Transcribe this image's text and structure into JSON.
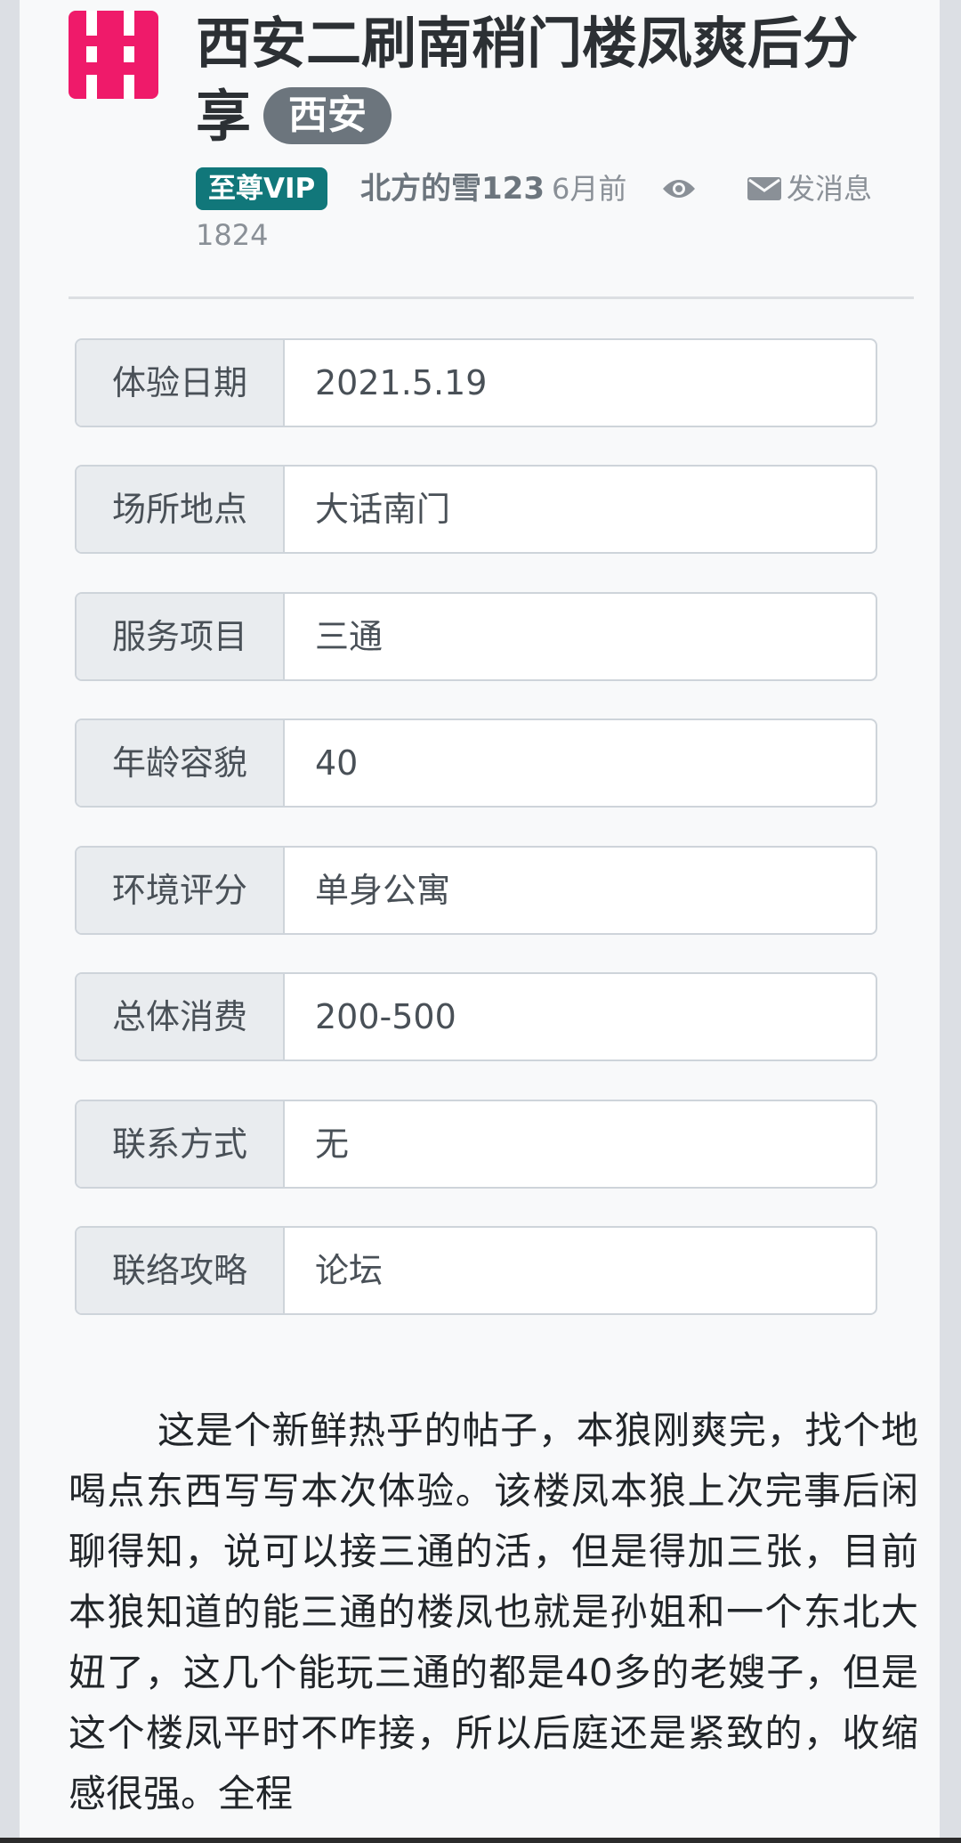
{
  "post": {
    "title": "西安二刷南稍门楼凤爽后分享",
    "city": "西安",
    "vip_badge": "至尊VIP",
    "author": "北方的雪123",
    "time": "6月前",
    "views": "1824",
    "message_button": "发消息"
  },
  "details": [
    {
      "label": "体验日期",
      "value": "2021.5.19"
    },
    {
      "label": "场所地点",
      "value": "大话南门"
    },
    {
      "label": "服务项目",
      "value": "三通"
    },
    {
      "label": "年龄容貌",
      "value": "40"
    },
    {
      "label": "环境评分",
      "value": "单身公寓"
    },
    {
      "label": "总体消费",
      "value": "200-500"
    },
    {
      "label": "联系方式",
      "value": "无"
    },
    {
      "label": "联络攻略",
      "value": "论坛"
    }
  ],
  "body": "这是个新鲜热乎的帖子，本狼刚爽完，找个地喝点东西写写本次体验。该楼凤本狼上次完事后闲聊得知，说可以接三通的活，但是得加三张，目前本狼知道的能三通的楼凤也就是孙姐和一个东北大妞了，这几个能玩三通的都是40多的老嫂子，但是这个楼凤平时不咋接，所以后庭还是紧致的，收缩感很强。全程",
  "icons": [
    "logo-icon",
    "eye-icon",
    "envelope-icon"
  ],
  "colors": {
    "logo": "#ef1a6a",
    "vip": "#11777a",
    "badge": "#6c757d"
  }
}
